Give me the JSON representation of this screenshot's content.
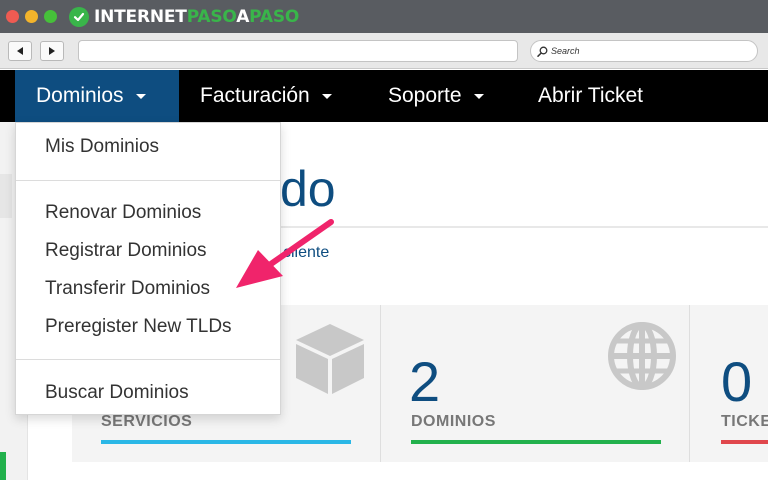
{
  "brand": {
    "word_white_1": "INTERNET",
    "word_green_1": "PASO",
    "word_white_2": "A",
    "word_green_2": "PASO"
  },
  "toolbar": {
    "back_icon": "back-arrow-icon",
    "forward_icon": "forward-arrow-icon",
    "search_placeholder": "Search"
  },
  "nav": {
    "items": [
      {
        "label": "Dominios"
      },
      {
        "label": "Facturación"
      },
      {
        "label": "Soporte"
      },
      {
        "label": "Abrir Ticket"
      }
    ]
  },
  "dropdown": {
    "items": [
      {
        "label": "Mis Dominios"
      },
      {
        "label": "Renovar Dominios"
      },
      {
        "label": "Registrar Dominios"
      },
      {
        "label": "Transferir Dominios"
      },
      {
        "label": "Preregister New TLDs"
      },
      {
        "label": "Buscar Dominios"
      }
    ]
  },
  "main": {
    "heading_partial": "do",
    "cliente_partial": "cliente"
  },
  "stats": [
    {
      "label": "SERVICIOS",
      "icon": "box-icon"
    },
    {
      "number": "2",
      "label": "DOMINIOS",
      "icon": "globe-icon"
    },
    {
      "number": "0",
      "label": "TICKE"
    }
  ],
  "colors": {
    "nav_active": "#0e4d80",
    "brand_green": "#39b54a",
    "arrow": "#f0246b",
    "servicios_line": "#2ab7e6",
    "dominios_line": "#22b14c",
    "tickets_line": "#e0474c"
  }
}
